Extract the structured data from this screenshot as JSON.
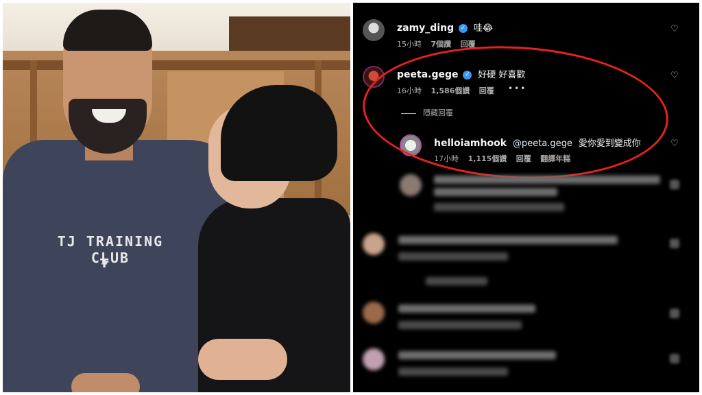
{
  "photo": {
    "shirt_text": "TJ TRAINING CLUB",
    "shirt_logo": "ℸ̅"
  },
  "comments": [
    {
      "username": "zamy_ding",
      "verified": true,
      "text": "哇😂",
      "time": "15小時",
      "likes": "7個讚",
      "reply": "回覆"
    },
    {
      "username": "peeta.gege",
      "verified": true,
      "text": "好硬 好喜歡",
      "time": "16小時",
      "likes": "1,586個讚",
      "reply": "回覆",
      "more": "•••"
    }
  ],
  "hide_replies": "隱藏回覆",
  "reply_comment": {
    "username": "helloiamhook",
    "mention": "@peeta.gege",
    "text": "愛你愛到變成你",
    "time": "17小時",
    "likes": "1,115個讚",
    "reply": "回覆",
    "translate": "翻譯年糕"
  },
  "icons": {
    "like": "heart-outline-icon",
    "verified": "verified-badge-icon"
  },
  "colors": {
    "highlight": "#e8221c",
    "verified": "#3897f0",
    "background": "#000000"
  }
}
